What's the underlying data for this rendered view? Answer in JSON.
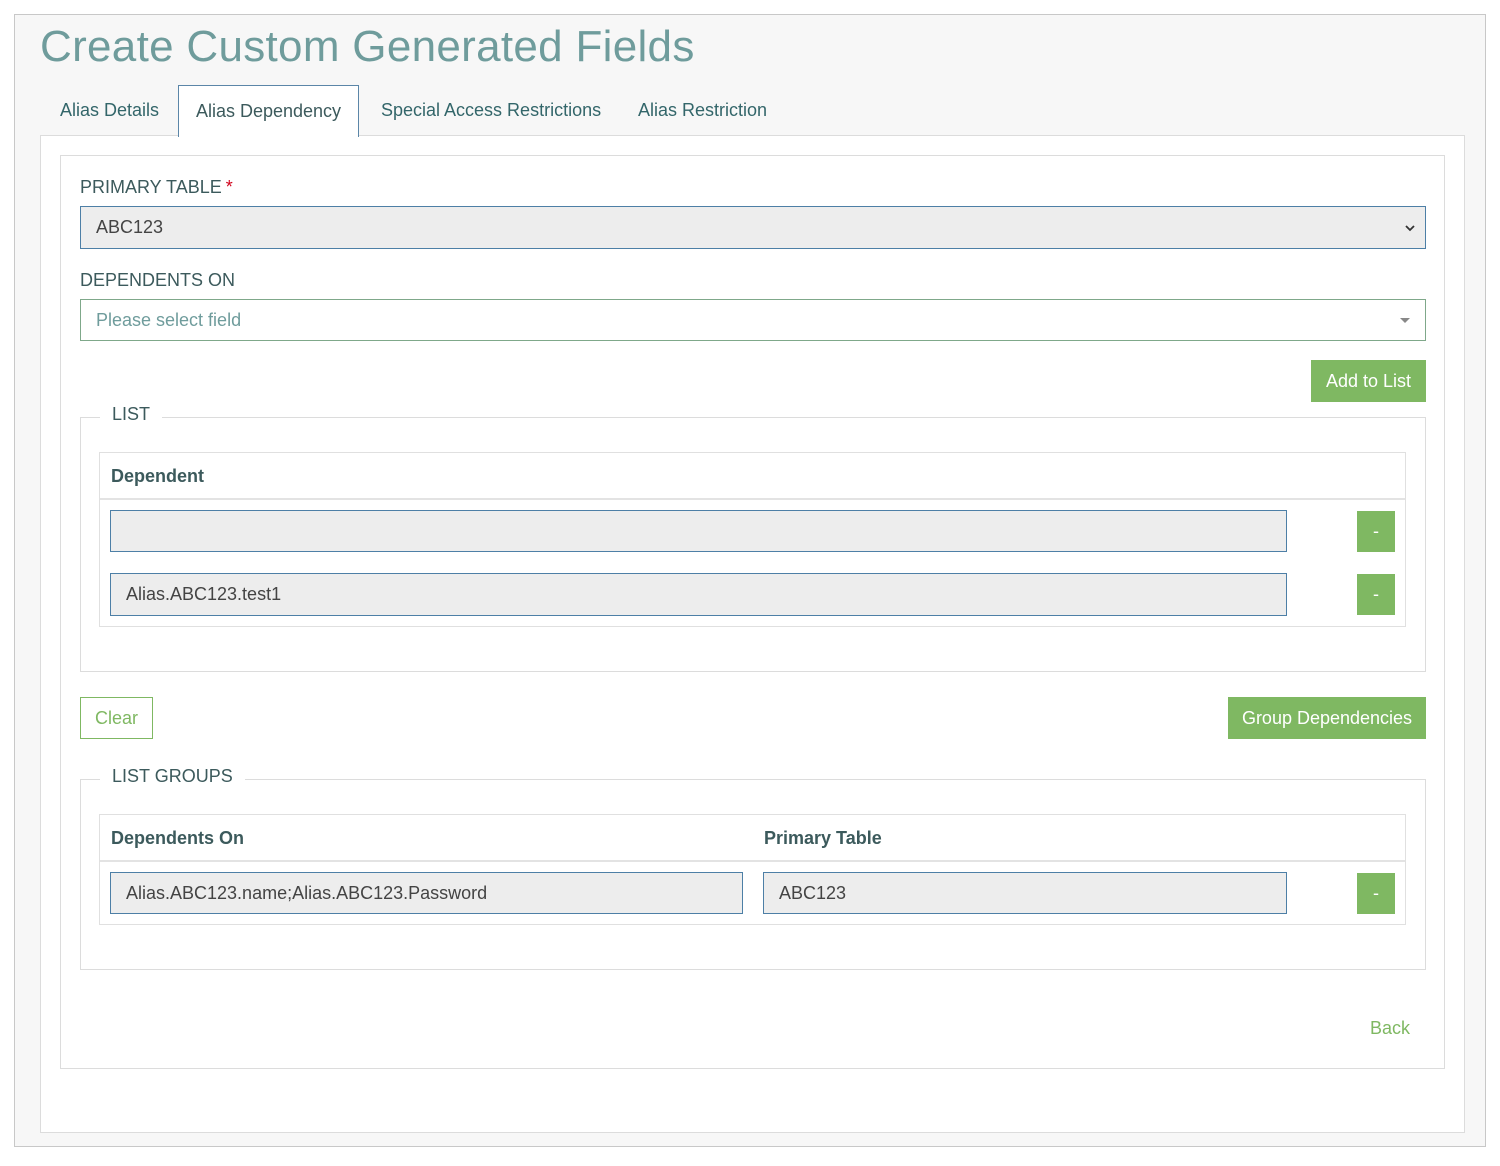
{
  "page": {
    "title": "Create Custom Generated Fields"
  },
  "tabs": [
    {
      "label": "Alias Details",
      "active": false
    },
    {
      "label": "Alias Dependency",
      "active": true
    },
    {
      "label": "Special Access Restrictions",
      "active": false
    },
    {
      "label": "Alias Restriction",
      "active": false
    }
  ],
  "form": {
    "primary_table": {
      "label": "PRIMARY TABLE",
      "required_mark": "*",
      "value": "ABC123"
    },
    "dependents_on": {
      "label": "DEPENDENTS ON",
      "placeholder": "Please select field"
    },
    "add_to_list_label": "Add to List"
  },
  "list": {
    "legend": "LIST",
    "header": "Dependent",
    "rows": [
      {
        "value": "",
        "remove_label": "-"
      },
      {
        "value": "Alias.ABC123.test1",
        "remove_label": "-"
      }
    ]
  },
  "actions": {
    "clear_label": "Clear",
    "group_label": "Group Dependencies"
  },
  "list_groups": {
    "legend": "LIST GROUPS",
    "headers": {
      "dependents_on": "Dependents On",
      "primary_table": "Primary Table"
    },
    "rows": [
      {
        "dependents_on": "Alias.ABC123.name;Alias.ABC123.Password",
        "primary_table": "ABC123",
        "remove_label": "-"
      }
    ]
  },
  "footer": {
    "back_label": "Back"
  },
  "colors": {
    "accent_green": "#7fb862",
    "title_teal": "#6f9c9c",
    "input_border_blue": "#4d7fa6"
  }
}
